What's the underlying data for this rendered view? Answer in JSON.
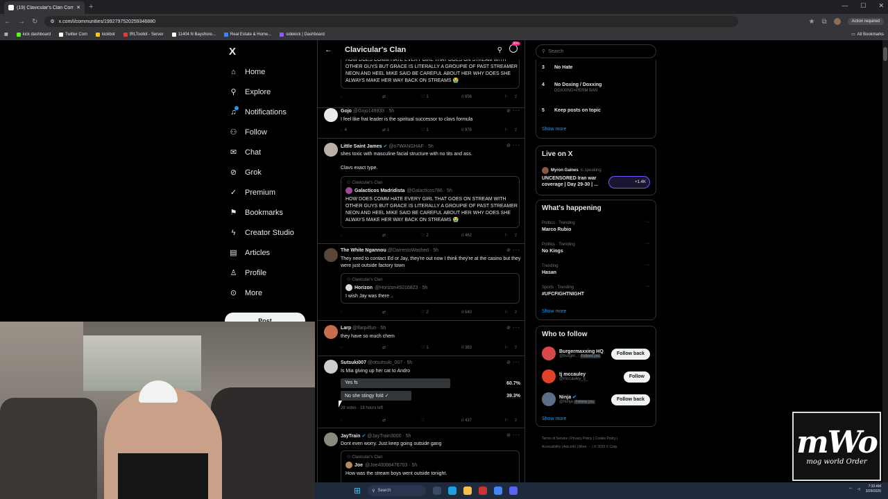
{
  "browser": {
    "tab_title": "(19) Clavicular's Clan Commun",
    "url": "x.com/i/communities/1992797520259346880",
    "action_label": "Action required",
    "bookmarks": [
      {
        "label": "kick dashboard",
        "color": "#53fc18"
      },
      {
        "label": "Twitter Com",
        "color": "#ffffff"
      },
      {
        "label": "kickbot",
        "color": "#f5c518"
      },
      {
        "label": "IRLToolkit - Server",
        "color": "#e53935"
      },
      {
        "label": "11404 N Bayshore...",
        "color": "#ffffff"
      },
      {
        "label": "Real Estate & Home...",
        "color": "#3b82f6"
      },
      {
        "label": "sidekick | Dashboard",
        "color": "#8b5cf6"
      }
    ],
    "all_bookmarks": "All Bookmarks"
  },
  "nav": {
    "logo": "X",
    "items": [
      "Home",
      "Explore",
      "Notifications",
      "Follow",
      "Chat",
      "Grok",
      "Premium",
      "Bookmarks",
      "Creator Studio",
      "Articles",
      "Profile",
      "More"
    ],
    "post": "Post"
  },
  "header": {
    "title": "Clavicular's Clan",
    "badge": "20+"
  },
  "tweets": {
    "top_quote_text": "HOW DOES COMM HATE EVERY GIRL THAT GOES ON STREAM WITH OTHER GUYS BUT GRACE IS LITERALLY A GROUPIE OF PAST STREAMER NEON AND HEEL MIKE SAID BE CAREFUL ABOUT HER WHY DOES SHE ALWAYS MAKE HER WAY BACK ON STREAMS 😭",
    "top_actions": {
      "reply": "",
      "repost": "",
      "like": "1",
      "views": "656"
    },
    "gojo": {
      "name": "Gojo",
      "handle": "@Gojo149933 · 5h",
      "text": "I feel like frat leader is the spiritual successor to clavs formula",
      "reply": "4",
      "repost": "1",
      "like": "1",
      "views": "978"
    },
    "james": {
      "name": "Little Saint James",
      "handle": "@o7WANGHAF · 5h",
      "text1": "shes toxic with masculine facial structure with no tits and ass.",
      "text2": "Clavs exact type.",
      "community": "Clavicular's Clan",
      "q_name": "Galacticos Madridista",
      "q_handle": "@Galacticos786 · 5h",
      "q_text": "HOW DOES COMM HATE EVERY GIRL THAT GOES ON STREAM WITH OTHER GUYS BUT GRACE IS LITERALLY A GROUPIE OF PAST STREAMER NEON AND HEEL MIKE SAID BE CAREFUL ABOUT HER WHY DOES SHE ALWAYS MAKE HER WAY BACK ON STREAMS 😭",
      "reply": "",
      "repost": "",
      "like": "2",
      "views": "462"
    },
    "ngannou": {
      "name": "The White Ngannou",
      "handle": "@DarrenIsWashed · 5h",
      "text": "They need to contact Ed or Jay, they're out now I think they're at the casino but they were just outside factory town",
      "community": "Clavicular's Clan",
      "q_name": "Horizon",
      "q_handle": "@Horizon49216823 · 5h",
      "q_text": "I wish Jay was there ..",
      "reply": "",
      "repost": "",
      "like": "2",
      "views": "640"
    },
    "larp": {
      "name": "Larp",
      "handle": "@llarp4fun · 5h",
      "text": "they have so much chem",
      "reply": "",
      "repost": "",
      "like": "1",
      "views": "383"
    },
    "sutsuki": {
      "name": "Sutsuki007",
      "handle": "@otsutsuki_007 · 5h",
      "text": "Is Mia giving up her cat to Andro",
      "poll": [
        {
          "label": "Yes fs",
          "pct": "60.7%",
          "value": 60.7
        },
        {
          "label": "No she stingy fold ✓",
          "pct": "39.3%",
          "value": 39.3
        }
      ],
      "poll_meta": "28 votes · 18 hours left",
      "views": "437"
    },
    "jaytrain": {
      "name": "JayTrain",
      "handle": "@JayTrain3000 · 5h",
      "text": "Dont even worry. Just keep going outside gang",
      "community": "Clavicular's Clan",
      "q_name": "Joe",
      "q_handle": "@Joe40088476703 · 5h",
      "q_text": "How was the stream boys went outside tonight."
    }
  },
  "right": {
    "search_placeholder": "Search",
    "rules": [
      {
        "num": "3",
        "label": "No Hate",
        "sub": ""
      },
      {
        "num": "4",
        "label": "No Doxing / Doxxing",
        "sub": "DOXXING=PERM BAN"
      },
      {
        "num": "5",
        "label": "Keep posts on topic",
        "sub": ""
      }
    ],
    "show_more": "Show more",
    "live": {
      "title": "Live on X",
      "host": "Myron Gaines",
      "host_suffix": "is speaking",
      "stream_title": "UNCENSORED Iran war coverage | Day 29-30 | ...",
      "count": "+1.4K"
    },
    "happening": {
      "title": "What's happening",
      "trends": [
        {
          "cat": "Politics · Trending",
          "name": "Marco Rubio"
        },
        {
          "cat": "Politics · Trending",
          "name": "No Kings"
        },
        {
          "cat": "Trending",
          "name": "Hasan"
        },
        {
          "cat": "Sports · Trending",
          "name": "#UFCFIGHTNIGHT"
        }
      ]
    },
    "who": {
      "title": "Who to follow",
      "people": [
        {
          "name": "Burgermaxxing HQ",
          "handle": "@burger...",
          "follows_you": "Follows you",
          "button": "Follow back",
          "color": "#d8474a"
        },
        {
          "name": "tj mccauley",
          "handle": "@mccauley_tj_",
          "follows_you": "",
          "button": "Follow",
          "color": "#e0412a"
        },
        {
          "name": "Ninja",
          "handle": "@Ninja",
          "follows_you": "Follows you",
          "button": "Follow back",
          "color": "#5a6e8a"
        }
      ]
    },
    "footer1": "Terms of Service  |  Privacy Policy  |  Cookie Policy  |",
    "footer2": "Accessibility  |  Ads info  |  More ···  |  © 2026 X Corp."
  },
  "watermark": {
    "big": "mWo",
    "small": "mog world Order"
  },
  "taskbar": {
    "search": "Search",
    "time": "7:33 AM",
    "date": "3/28/2026"
  }
}
